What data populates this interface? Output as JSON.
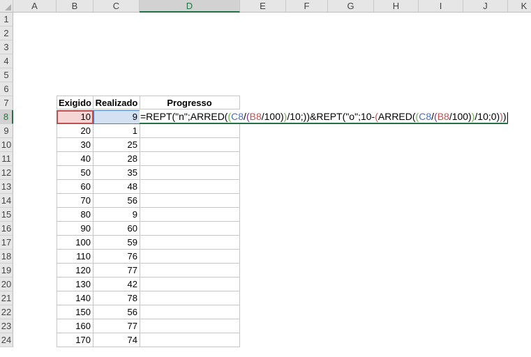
{
  "columns": [
    "A",
    "B",
    "C",
    "D",
    "E",
    "F",
    "G",
    "H",
    "I",
    "J",
    "K"
  ],
  "rows": [
    1,
    2,
    3,
    4,
    5,
    6,
    7,
    8,
    9,
    10,
    11,
    12,
    13,
    14,
    15,
    16,
    17,
    18,
    19,
    20,
    21,
    22,
    23,
    24
  ],
  "active_column": "D",
  "active_row": 8,
  "table": {
    "headers": {
      "exigido": "Exigido",
      "realizado": "Realizado",
      "progresso": "Progresso"
    },
    "rows": [
      {
        "row": 8,
        "exigido": "10",
        "realizado": "9"
      },
      {
        "row": 9,
        "exigido": "20",
        "realizado": "1"
      },
      {
        "row": 10,
        "exigido": "30",
        "realizado": "25"
      },
      {
        "row": 11,
        "exigido": "40",
        "realizado": "28"
      },
      {
        "row": 12,
        "exigido": "50",
        "realizado": "35"
      },
      {
        "row": 13,
        "exigido": "60",
        "realizado": "48"
      },
      {
        "row": 14,
        "exigido": "70",
        "realizado": "56"
      },
      {
        "row": 15,
        "exigido": "80",
        "realizado": "9"
      },
      {
        "row": 17,
        "exigido": "100",
        "realizado": "59"
      },
      {
        "row": 16,
        "exigido": "90",
        "realizado": "60"
      },
      {
        "row": 18,
        "exigido": "110",
        "realizado": "76"
      },
      {
        "row": 19,
        "exigido": "120",
        "realizado": "77"
      },
      {
        "row": 20,
        "exigido": "130",
        "realizado": "42"
      },
      {
        "row": 21,
        "exigido": "140",
        "realizado": "78"
      },
      {
        "row": 22,
        "exigido": "150",
        "realizado": "56"
      },
      {
        "row": 23,
        "exigido": "160",
        "realizado": "77"
      },
      {
        "row": 24,
        "exigido": "170",
        "realizado": "74"
      }
    ]
  },
  "formula": {
    "tokens": [
      {
        "t": "=REPT(\"n\";ARRED(",
        "c": "black"
      },
      {
        "t": "(",
        "c": "green"
      },
      {
        "t": "C8",
        "c": "blue"
      },
      {
        "t": "/",
        "c": "black"
      },
      {
        "t": "(",
        "c": "purple"
      },
      {
        "t": "B8",
        "c": "red"
      },
      {
        "t": "/100)",
        "c": "black"
      },
      {
        "t": ")",
        "c": "green"
      },
      {
        "t": "/10;))&REPT(\"o\";10-",
        "c": "black"
      },
      {
        "t": "(",
        "c": "red"
      },
      {
        "t": "ARRED(",
        "c": "black"
      },
      {
        "t": "(",
        "c": "green"
      },
      {
        "t": "C8",
        "c": "blue"
      },
      {
        "t": "/",
        "c": "black"
      },
      {
        "t": "(",
        "c": "purple"
      },
      {
        "t": "B8",
        "c": "red"
      },
      {
        "t": "/100)",
        "c": "black"
      },
      {
        "t": ")",
        "c": "green"
      },
      {
        "t": "/10;0)",
        "c": "black"
      },
      {
        "t": ")",
        "c": "red"
      },
      {
        "t": ")",
        "c": "black"
      }
    ]
  },
  "colors": {
    "accent": "#217346",
    "ref_b": "#c0504d",
    "ref_c": "#4472c4"
  }
}
